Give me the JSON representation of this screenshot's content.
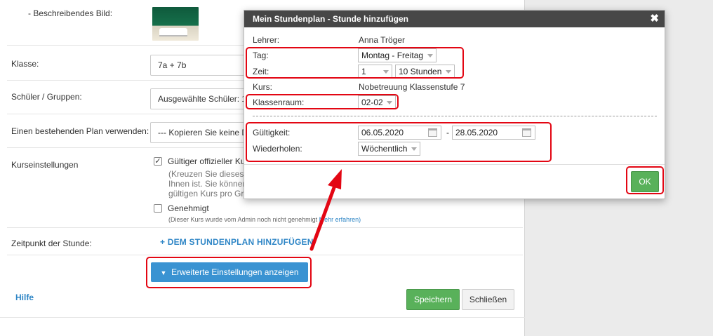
{
  "form": {
    "image_label": "- Beschreibendes Bild:",
    "class_label": "Klasse:",
    "class_value": "7a + 7b",
    "students_label": "Schüler / Gruppen:",
    "students_value": "Ausgewählte Schüler: 1",
    "plan_label": "Einen bestehenden Plan verwenden:",
    "plan_value": "--- Kopieren Sie keine D",
    "course_settings_label": "Kurseinstellungen",
    "official_course_label": "Gültiger offizieller Ku",
    "hint_line1": "(Kreuzen Sie dieses",
    "hint_line2": "Ihnen ist. Sie könner",
    "hint_line3": "gültigen Kurs pro Gr",
    "approved_label": "Genehmigt",
    "approved_note": "(Dieser Kurs wurde vom Admin noch nicht genehmigt",
    "learn_more": "Mehr erfahren)",
    "lesson_time_label": "Zeitpunkt der Stunde:",
    "add_to_schedule": "+ DEM STUNDENPLAN HINZUFÜGEN",
    "advanced_button": "Erweiterte Einstellungen anzeigen",
    "help": "Hilfe",
    "save_button": "Speichern",
    "close_button": "Schließen"
  },
  "dialog": {
    "title": "Mein Stundenplan - Stunde hinzufügen",
    "close_glyph": "✖",
    "teacher_label": "Lehrer:",
    "teacher_value": "Anna Tröger",
    "day_label": "Tag:",
    "day_value": "Montag - Freitag",
    "time_label": "Zeit:",
    "time_start": "1",
    "time_duration": "10 Stunden",
    "course_label": "Kurs:",
    "course_value": "Nobetreuung Klassenstufe 7",
    "room_label": "Klassenraum:",
    "room_value": "02-02",
    "validity_label": "Gültigkeit:",
    "validity_from": "06.05.2020",
    "validity_separator": "-",
    "validity_to": "28.05.2020",
    "repeat_label": "Wiederholen:",
    "repeat_value": "Wöchentlich",
    "ok_button": "OK"
  },
  "colors": {
    "highlight": "#e30613",
    "accent_blue": "#3a93d2",
    "accent_green": "#59b15a",
    "dialog_header": "#474747"
  }
}
